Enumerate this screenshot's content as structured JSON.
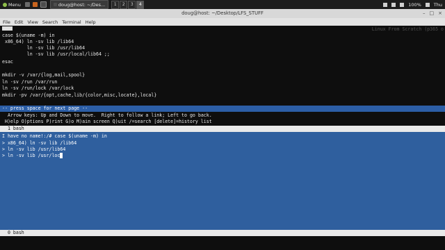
{
  "panel": {
    "menu_label": "Menu",
    "task_label": "doug@host: ~/Des...",
    "workspaces": [
      "1",
      "2",
      "3",
      "4"
    ],
    "battery": "100%",
    "clock": "Thu"
  },
  "window": {
    "title": "doug@host: ~/Desktop/LFS_STUFF",
    "minimize": "–",
    "maximize": "□",
    "close": "×"
  },
  "menubar": [
    "File",
    "Edit",
    "View",
    "Search",
    "Terminal",
    "Help"
  ],
  "doc": {
    "header_right": "Linux From Scratch (p365 o",
    "lines": [
      "case $(uname -m) in",
      " x86_64) ln -sv lib /lib64",
      "         ln -sv lib /usr/lib64",
      "         ln -sv lib /usr/local/lib64 ;;",
      "esac",
      "",
      "mkdir -v /var/{log,mail,spool}",
      "ln -sv /run /var/run",
      "ln -sv /run/lock /var/lock",
      "mkdir -pv /var/{opt,cache,lib/{color,misc,locate},local}"
    ]
  },
  "pager": {
    "status": "-- press space for next page --",
    "help1": "  Arrow keys: Up and Down to move.  Right to follow a link; Left to go back.",
    "help2": " H)elp O)ptions P)rint G)o M)ain screen Q)uit /=search [delete]=history list"
  },
  "tmux_top": "  1 bash",
  "pane": {
    "lines": [
      "I have no name!:/# case $(uname -m) in",
      "> x86_64) ln -sv lib /lib64",
      "> ln -sv lib /usr/lib64",
      "> ln -sv lib /usr/loc"
    ]
  },
  "tmux_bottom": "  0 bash"
}
